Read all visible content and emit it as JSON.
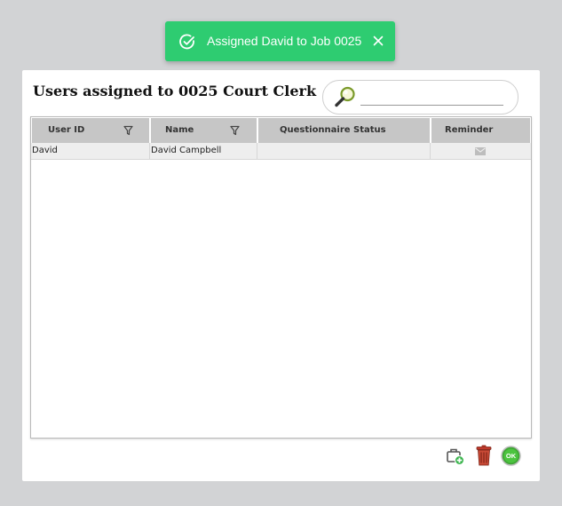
{
  "toast": {
    "message": "Assigned David to Job 0025",
    "icon": "check-circle-icon",
    "close_icon": "close-icon",
    "color": "#2ecc71"
  },
  "panel": {
    "title": "Users assigned to 0025 Court Clerk",
    "search": {
      "value": "",
      "placeholder": ""
    }
  },
  "table": {
    "columns": [
      "User ID",
      "Name",
      "Questionnaire Status",
      "Reminder"
    ],
    "rows": [
      {
        "user_id": "David",
        "name": "David Campbell",
        "questionnaire_status": "",
        "reminder_icon": "mail-icon"
      }
    ]
  },
  "toolbar": {
    "buttons": [
      "add-job-icon",
      "trash-icon",
      "ok-icon"
    ]
  }
}
